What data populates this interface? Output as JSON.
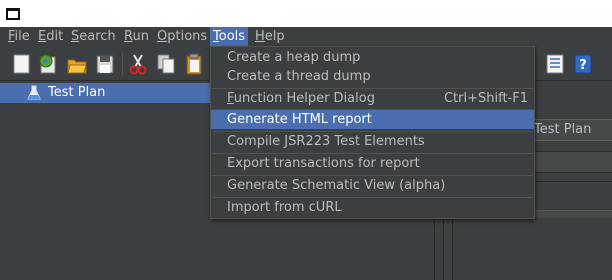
{
  "menubar": {
    "items": [
      {
        "label": "File",
        "mnemonic": "F",
        "rest": "ile"
      },
      {
        "label": "Edit",
        "mnemonic": "E",
        "rest": "dit"
      },
      {
        "label": "Search",
        "mnemonic": "S",
        "rest": "earch"
      },
      {
        "label": "Run",
        "mnemonic": "R",
        "rest": "un"
      },
      {
        "label": "Options",
        "mnemonic": "O",
        "rest": "ptions"
      },
      {
        "label": "Tools",
        "mnemonic": "T",
        "rest": "ools"
      },
      {
        "label": "Help",
        "mnemonic": "H",
        "rest": "elp"
      }
    ],
    "active": "Tools"
  },
  "toolbar": {
    "icons": [
      "new-icon",
      "templates-icon",
      "open-icon",
      "save-icon",
      "cut-icon",
      "copy-icon",
      "paste-icon",
      "function-helper-icon",
      "help-icon"
    ]
  },
  "tree": {
    "selected_label": "Test Plan",
    "icon": "flask-icon"
  },
  "right_panel": {
    "name_value": "Test Plan"
  },
  "tools_menu": {
    "items": [
      {
        "label": "Create a heap dump",
        "shortcut": ""
      },
      {
        "label": "Create a thread dump",
        "shortcut": ""
      },
      {
        "label": "Function Helper Dialog",
        "mnemonic": "F",
        "rest": "unction Helper Dialog",
        "shortcut": "Ctrl+Shift-F1"
      },
      {
        "label": "Generate HTML report",
        "shortcut": "",
        "highlighted": true
      },
      {
        "label": "Compile JSR223 Test Elements",
        "shortcut": ""
      },
      {
        "label": "Export transactions for report",
        "shortcut": ""
      },
      {
        "label": "Generate Schematic View (alpha)",
        "shortcut": ""
      },
      {
        "label": "Import from cURL",
        "shortcut": ""
      }
    ]
  },
  "colors": {
    "background": "#3c3f41",
    "selection": "#4b6eaf",
    "text": "#bbbbbb",
    "selected_text": "#ffffff"
  }
}
